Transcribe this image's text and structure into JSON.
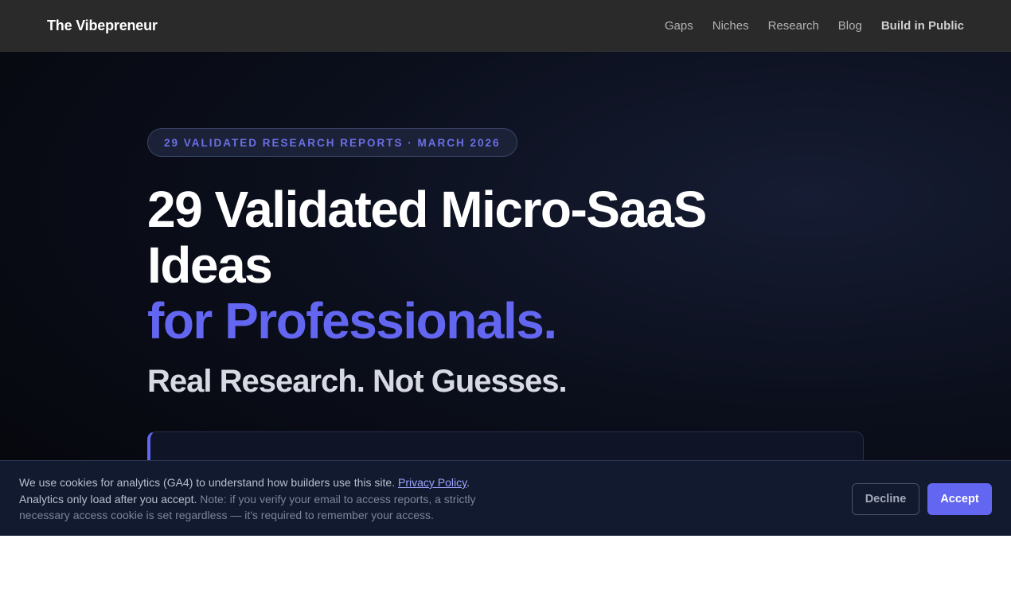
{
  "nav": {
    "brand": "The Vibepreneur",
    "links": [
      "Gaps",
      "Niches",
      "Research",
      "Blog",
      "Build in Public"
    ]
  },
  "hero": {
    "pill": "29 VALIDATED RESEARCH REPORTS · MARCH 2026",
    "title_line1": "29 Validated Micro-SaaS",
    "title_line2": "Ideas",
    "title_accent": "for Professionals.",
    "subhead": "Real Research. Not Guesses."
  },
  "cookie": {
    "text_part1": "We use cookies for analytics (GA4) to understand how builders use this site. ",
    "privacy_link": "Privacy Policy",
    "text_part2": ".",
    "text_line2": "Analytics only load after you accept. ",
    "note": "Note: if you verify your email to access reports, a strictly necessary access cookie is set regardless — it's required to remember your access.",
    "decline_label": "Decline",
    "accept_label": "Accept"
  },
  "colors": {
    "accent": "#6366f1",
    "nav_bg": "#2a2a2a",
    "banner_bg": "#111a2e"
  }
}
